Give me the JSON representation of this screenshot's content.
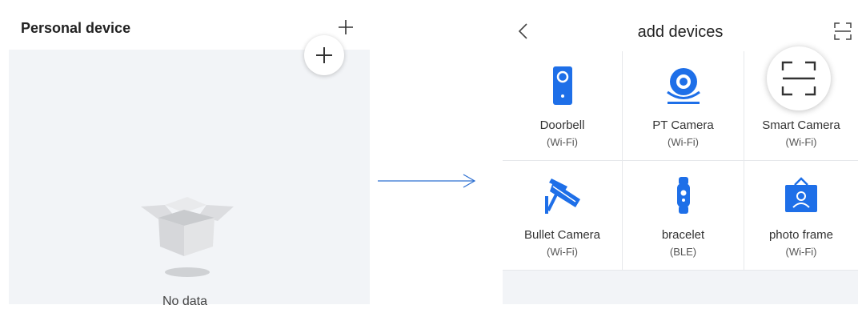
{
  "left": {
    "title": "Personal device",
    "empty_text": "No data"
  },
  "right": {
    "title": "add devices",
    "devices": [
      {
        "name": "Doorbell",
        "protocol": "(Wi-Fi)",
        "icon": "doorbell-icon"
      },
      {
        "name": "PT Camera",
        "protocol": "(Wi-Fi)",
        "icon": "pt-camera-icon"
      },
      {
        "name": "Smart Camera",
        "protocol": "(Wi-Fi)",
        "icon": "smart-camera-icon"
      },
      {
        "name": "Bullet Camera",
        "protocol": "(Wi-Fi)",
        "icon": "bullet-camera-icon"
      },
      {
        "name": "bracelet",
        "protocol": "(BLE)",
        "icon": "bracelet-icon"
      },
      {
        "name": "photo frame",
        "protocol": "(Wi-Fi)",
        "icon": "photo-frame-icon"
      }
    ]
  },
  "colors": {
    "accent": "#1e6fe8",
    "panel_bg": "#f2f4f7",
    "divider": "#e6e8eb"
  }
}
